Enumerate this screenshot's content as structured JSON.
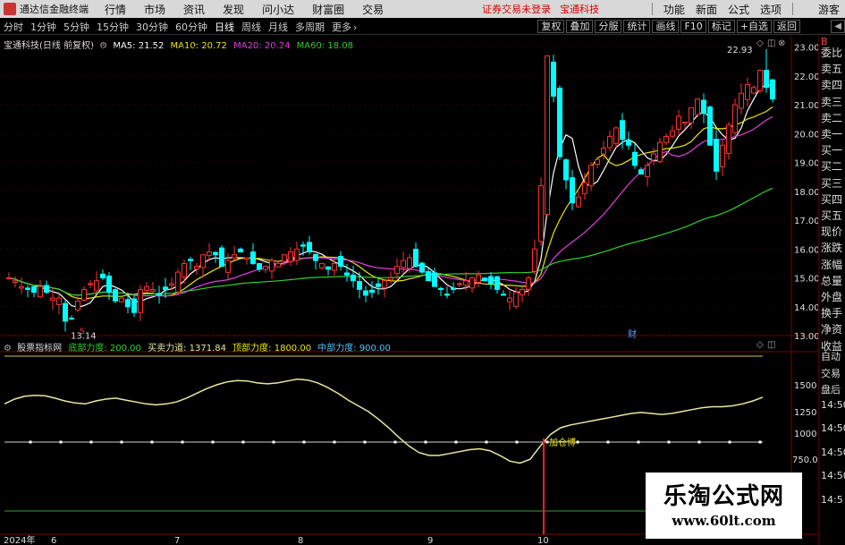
{
  "title_bar": {
    "app_name": "通达信金融终端",
    "menus": [
      "行情",
      "市场",
      "资讯",
      "发现",
      "问小达",
      "财富圈",
      "交易"
    ],
    "notice": "证券交易未登录",
    "stock_name": "宝通科技",
    "right_items": [
      "功能",
      "新面",
      "公式",
      "选项"
    ],
    "guest": "游客"
  },
  "toolbar": {
    "periods": [
      "分时",
      "1分钟",
      "5分钟",
      "15分钟",
      "30分钟",
      "60分钟",
      "日线",
      "周线",
      "月线",
      "多周期",
      "更多"
    ],
    "active_period": "日线",
    "more_arrow": "›",
    "right_buttons": [
      "复权",
      "叠加",
      "分服",
      "统计",
      "画线",
      "F10",
      "标记",
      "+自选",
      "返回"
    ],
    "side_icon": "◀"
  },
  "main_chart": {
    "header_title": "宝通科技(日线 前复权)",
    "indicators": [
      {
        "label": "MA5: 21.52",
        "color": "#ffffff"
      },
      {
        "label": "MA10: 20.72",
        "color": "#e8e800"
      },
      {
        "label": "MA20: 20.24",
        "color": "#e040e0"
      },
      {
        "label": "MA60: 18.08",
        "color": "#30d030"
      }
    ],
    "price_axis": [
      "23.00",
      "22.00",
      "21.00",
      "20.00",
      "19.00",
      "18.00",
      "17.00",
      "16.00",
      "15.00",
      "14.00",
      "13.00"
    ],
    "high_marker": "22.93",
    "low_marker": "13.14",
    "fin_marker": "财",
    "s_marker": "S",
    "controls": [
      "◇",
      "◫",
      "⊗"
    ]
  },
  "sub_chart": {
    "header_title": "股票指标网",
    "indicators": [
      {
        "label": "底部力度: 200.00",
        "color": "#30d030"
      },
      {
        "label": "买卖力道: 1371.84",
        "color": "#e8e8a0"
      },
      {
        "label": "顶部力度: 1800.00",
        "color": "#e8e800"
      },
      {
        "label": "中部力度: 900.00",
        "color": "#4fc3f7"
      }
    ],
    "axis": [
      "1500",
      "1250",
      "1000",
      "750.00"
    ],
    "signal_label": "加仓博",
    "controls": [
      "◇",
      "◫"
    ]
  },
  "date_axis": [
    "2024年",
    "6",
    "7",
    "8",
    "9",
    "10"
  ],
  "right_panel": {
    "top": "B",
    "rows": [
      "委比",
      "卖五",
      "卖四",
      "卖三",
      "卖二",
      "卖一",
      "买一",
      "买二",
      "买三",
      "买四",
      "买五",
      "现价",
      "涨跌",
      "涨幅",
      "总量",
      "外盘",
      "换手",
      "净资",
      "收益",
      "自动",
      "交易",
      "盘后",
      "14:50",
      "14:50",
      "14:50",
      "14:50",
      "14:5"
    ]
  },
  "watermark": {
    "cn": "乐淘公式网",
    "url": "www.60lt.com"
  },
  "colors": {
    "up": "#ff3030",
    "down": "#00ffff",
    "ma5": "#ffffff",
    "ma10": "#e8e800",
    "ma20": "#e040e0",
    "ma60": "#30d030",
    "osc": "#e8e8a0"
  },
  "chart_data": [
    {
      "type": "candlestick",
      "title": "宝通科技(日线 前复权)",
      "ylim": [
        13.0,
        23.3
      ],
      "x_ticks": [
        "2024年",
        "6",
        "7",
        "8",
        "9",
        "10"
      ],
      "close": [
        15.0,
        14.9,
        14.7,
        14.6,
        14.5,
        14.7,
        14.5,
        14.3,
        14.3,
        13.5,
        13.6,
        14.2,
        14.6,
        14.8,
        14.9,
        15.0,
        14.5,
        14.2,
        14.3,
        14.0,
        13.8,
        14.6,
        14.7,
        14.6,
        14.4,
        14.6,
        14.8,
        15.2,
        15.5,
        15.6,
        15.4,
        15.8,
        15.9,
        15.8,
        15.4,
        15.6,
        15.8,
        15.9,
        15.7,
        15.5,
        15.3,
        15.4,
        15.6,
        15.5,
        15.8,
        15.9,
        16.0,
        16.1,
        15.9,
        15.6,
        15.5,
        15.3,
        15.5,
        15.4,
        15.1,
        14.9,
        14.6,
        14.4,
        14.5,
        14.7,
        14.9,
        15.0,
        15.4,
        15.6,
        15.7,
        15.4,
        15.2,
        14.9,
        14.7,
        14.6,
        14.4,
        14.6,
        14.8,
        14.9,
        15.0,
        15.1,
        14.9,
        14.8,
        14.6,
        14.4,
        14.3,
        14.5,
        14.6,
        15.0,
        16.0,
        18.2,
        22.7,
        21.3,
        19.2,
        18.4,
        17.6,
        17.8,
        18.3,
        18.9,
        19.1,
        19.5,
        19.9,
        20.2,
        19.8,
        19.6,
        18.9,
        18.6,
        18.9,
        19.3,
        19.7,
        19.9,
        20.1,
        20.6,
        20.4,
        20.9,
        21.2,
        20.7,
        19.6,
        18.7,
        19.6,
        20.3,
        21.0,
        21.4,
        21.7,
        21.6,
        22.2,
        21.6,
        21.2
      ],
      "ma5_last": 21.52,
      "ma10_last": 20.72,
      "ma20_last": 20.24,
      "ma60_last": 18.08,
      "high_label": 22.93,
      "low_label": 13.14
    },
    {
      "type": "line",
      "title": "股票指标网",
      "ylim": [
        300,
        1900
      ],
      "series": [
        {
          "name": "买卖力道",
          "last": 1371.84
        },
        {
          "name": "顶部力度",
          "value": 1800.0
        },
        {
          "name": "中部力度",
          "value": 900.0
        },
        {
          "name": "底部力度",
          "value": 200.0
        }
      ],
      "signal": "加仓博"
    }
  ]
}
